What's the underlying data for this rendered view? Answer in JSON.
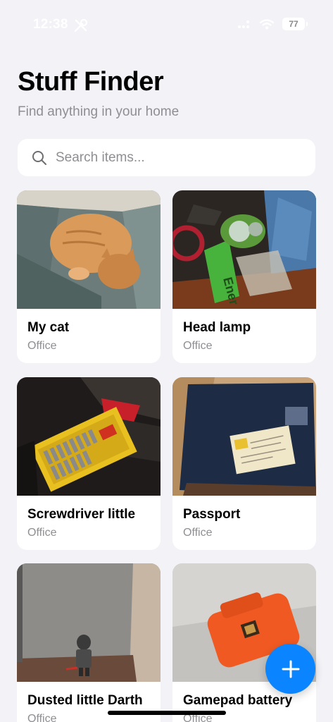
{
  "status_bar": {
    "time": "12:38",
    "battery": "77"
  },
  "header": {
    "title": "Stuff Finder",
    "subtitle": "Find anything in your home"
  },
  "search": {
    "placeholder": "Search items..."
  },
  "items": [
    {
      "name": "My cat",
      "location": "Office"
    },
    {
      "name": "Head lamp",
      "location": "Office"
    },
    {
      "name": "Screwdriver little",
      "location": "Office"
    },
    {
      "name": "Passport",
      "location": "Office"
    },
    {
      "name": "Dusted little Darth",
      "location": "Office"
    },
    {
      "name": "Gamepad battery",
      "location": "Office"
    }
  ],
  "colors": {
    "background": "#f2f2f7",
    "accent": "#0a84ff",
    "secondary_text": "#8e8e93"
  },
  "icons": {
    "search": "search-icon",
    "add": "plus-icon"
  }
}
